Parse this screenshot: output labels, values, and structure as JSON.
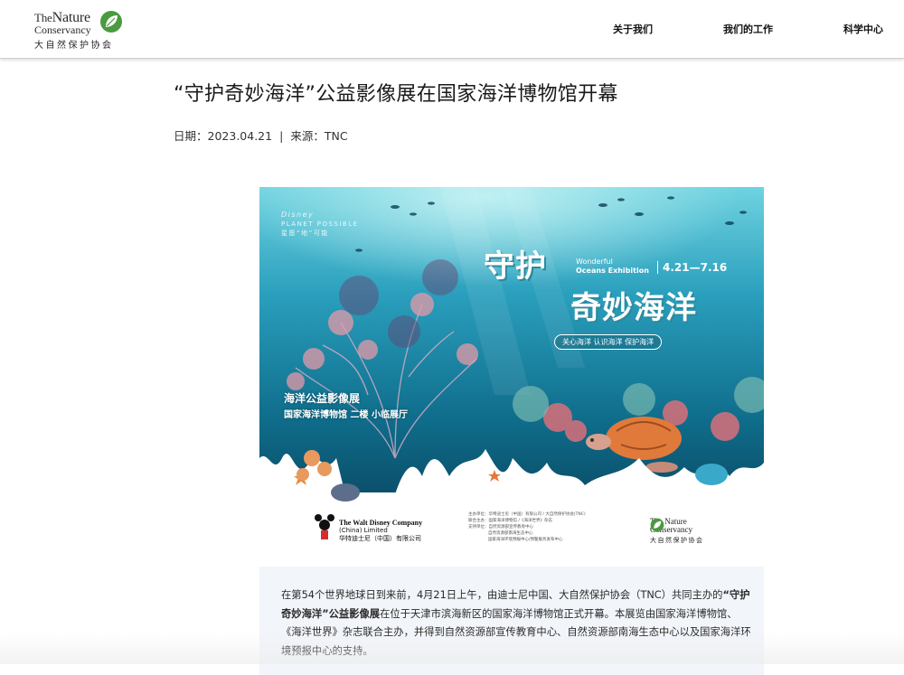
{
  "header": {
    "logo": {
      "line1a": "The",
      "line1b": "Nature",
      "line2": "Conservancy",
      "line3": "大自然保护协会"
    },
    "nav": {
      "about": "关于我们",
      "work": "我们的工作",
      "science": "科学中心"
    }
  },
  "article": {
    "title": "“守护奇妙海洋”公益影像展在国家海洋博物馆开幕",
    "date_label": "日期：",
    "date": "2023.04.21",
    "separator": "|",
    "source_label": "来源：",
    "source": "TNC"
  },
  "poster": {
    "brand_disney": "Disney",
    "brand_planet": "PLANET POSSIBLE",
    "brand_cn": "星愿“地”可能",
    "main_line1": "守护",
    "main_line2": "奇妙海洋",
    "wonderful": "Wonderful",
    "oceans": "Oceans Exhibition",
    "dates": "4.21—7.16",
    "slogan": "关心海洋  认识海洋  保护海洋",
    "exhibit_title": "海洋公益影像展",
    "exhibit_location": "国家海洋博物馆 二楼  小临展厅",
    "disney_company": "The Walt Disney Company",
    "disney_china": "(China) Limited",
    "disney_cn": "华特迪士尼（中国）有限公司",
    "sponsors": [
      "主办单位：华特迪士尼（中国）有限公司 / 大自然保护协会(TNC)",
      "联合主办：国家海洋博物馆 /《海洋世界》杂志",
      "支持单位：自然资源部宣传教育中心",
      "自然资源部南海生态中心",
      "国家海洋环境预报中心/预警服务发布中心"
    ],
    "tnc_line1": "The Nature",
    "tnc_line2": "Conservancy",
    "tnc_cn": "大自然保护协会"
  },
  "body": {
    "p1_pre": "在第54个世界地球日到来前，4月21日上午，由迪士尼中国、大自然保护协会（TNC）共同主办的",
    "p1_strong": "“守护奇妙海洋”公益影像展",
    "p1_post": "在位于天津市滨海新区的国家海洋博物馆正式开幕。本展览由国家海洋博物馆、《海洋世界》杂志联合主办，并得到自然资源部宣传教育中心、自然资源部南海生态中心以及国家海洋环境预报中心的支持。"
  },
  "colors": {
    "ocean_deep": "#0d6d8f",
    "ocean_light": "#5cc9dc",
    "coral": "#d9707a",
    "tnc_green": "#4a9a3f"
  }
}
